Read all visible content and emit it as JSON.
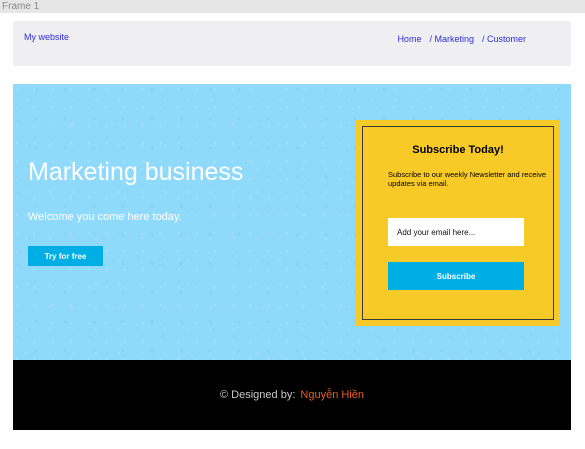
{
  "frame": {
    "label": "Frame 1"
  },
  "header": {
    "brand": "My website",
    "nav": [
      {
        "label": "Home"
      },
      {
        "label": "/ Marketing"
      },
      {
        "label": "/ Customer"
      }
    ]
  },
  "hero": {
    "title": "Marketing business",
    "subtitle": "Welcome you come here today.",
    "cta_label": "Try for free"
  },
  "subscribe": {
    "title": "Subscribe Today!",
    "description": "Subscribe to our weekly Newsletter and receive updates via email.",
    "email_placeholder": "Add your email here...",
    "button_label": "Subscribe"
  },
  "footer": {
    "label": "© Designed by:",
    "author": "Nguyễn Hiền"
  },
  "colors": {
    "hero_bg": "#8fd9fb",
    "accent_blue": "#00aee6",
    "card_yellow": "#f8ca27",
    "link_blue": "#2c2cdc",
    "author_orange": "#f05a24"
  }
}
